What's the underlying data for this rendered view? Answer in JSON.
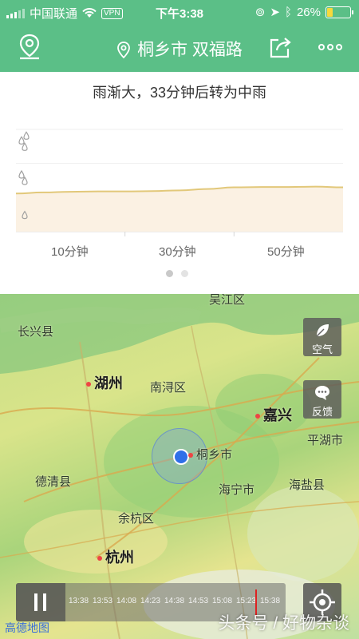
{
  "status_bar": {
    "carrier": "中国联通",
    "vpn": "VPN",
    "time": "下午3:38",
    "battery": "26%",
    "battery_level": 0.26
  },
  "header": {
    "location": "桐乡市 双福路"
  },
  "forecast": {
    "summary": "雨渐大，33分钟后转为中雨",
    "x_labels": [
      "10分钟",
      "30分钟",
      "50分钟"
    ]
  },
  "chart_data": {
    "type": "area",
    "x": [
      0,
      5,
      10,
      15,
      20,
      25,
      30,
      35,
      40,
      45,
      50,
      55,
      60
    ],
    "series": [
      {
        "values": [
          1.12,
          1.15,
          1.17,
          1.18,
          1.18,
          1.19,
          1.21,
          1.25,
          1.3,
          1.31,
          1.31,
          1.32,
          1.3
        ]
      }
    ],
    "levels": [
      "小雨",
      "中雨",
      "大雨"
    ],
    "ylim": [
      0,
      3
    ],
    "grid": true,
    "colors": {
      "line": "#e2c87a",
      "fill": "#fbf1e3"
    }
  },
  "map": {
    "labels": {
      "changxing": "长兴县",
      "wujiang": "吴江区",
      "huzhou": "湖州",
      "nanxun": "南浔区",
      "jiaxing": "嘉兴",
      "pinghu": "平湖市",
      "tongxiang": "桐乡市",
      "deqing": "德清县",
      "haining": "海宁市",
      "haiyan": "海盐县",
      "yuhang": "余杭区",
      "hangzhou": "杭州"
    },
    "buttons": {
      "air": "空气",
      "feedback": "反馈"
    },
    "timeline": [
      "13:38",
      "13:53",
      "14:08",
      "14:23",
      "14:38",
      "14:53",
      "15:08",
      "15:23",
      "15:38"
    ],
    "watermark": "头条号 / 好物杂谈",
    "credit": "高德地图"
  },
  "colors": {
    "brand_green": "#5bbf87",
    "location_blue": "#2f6fe8"
  }
}
